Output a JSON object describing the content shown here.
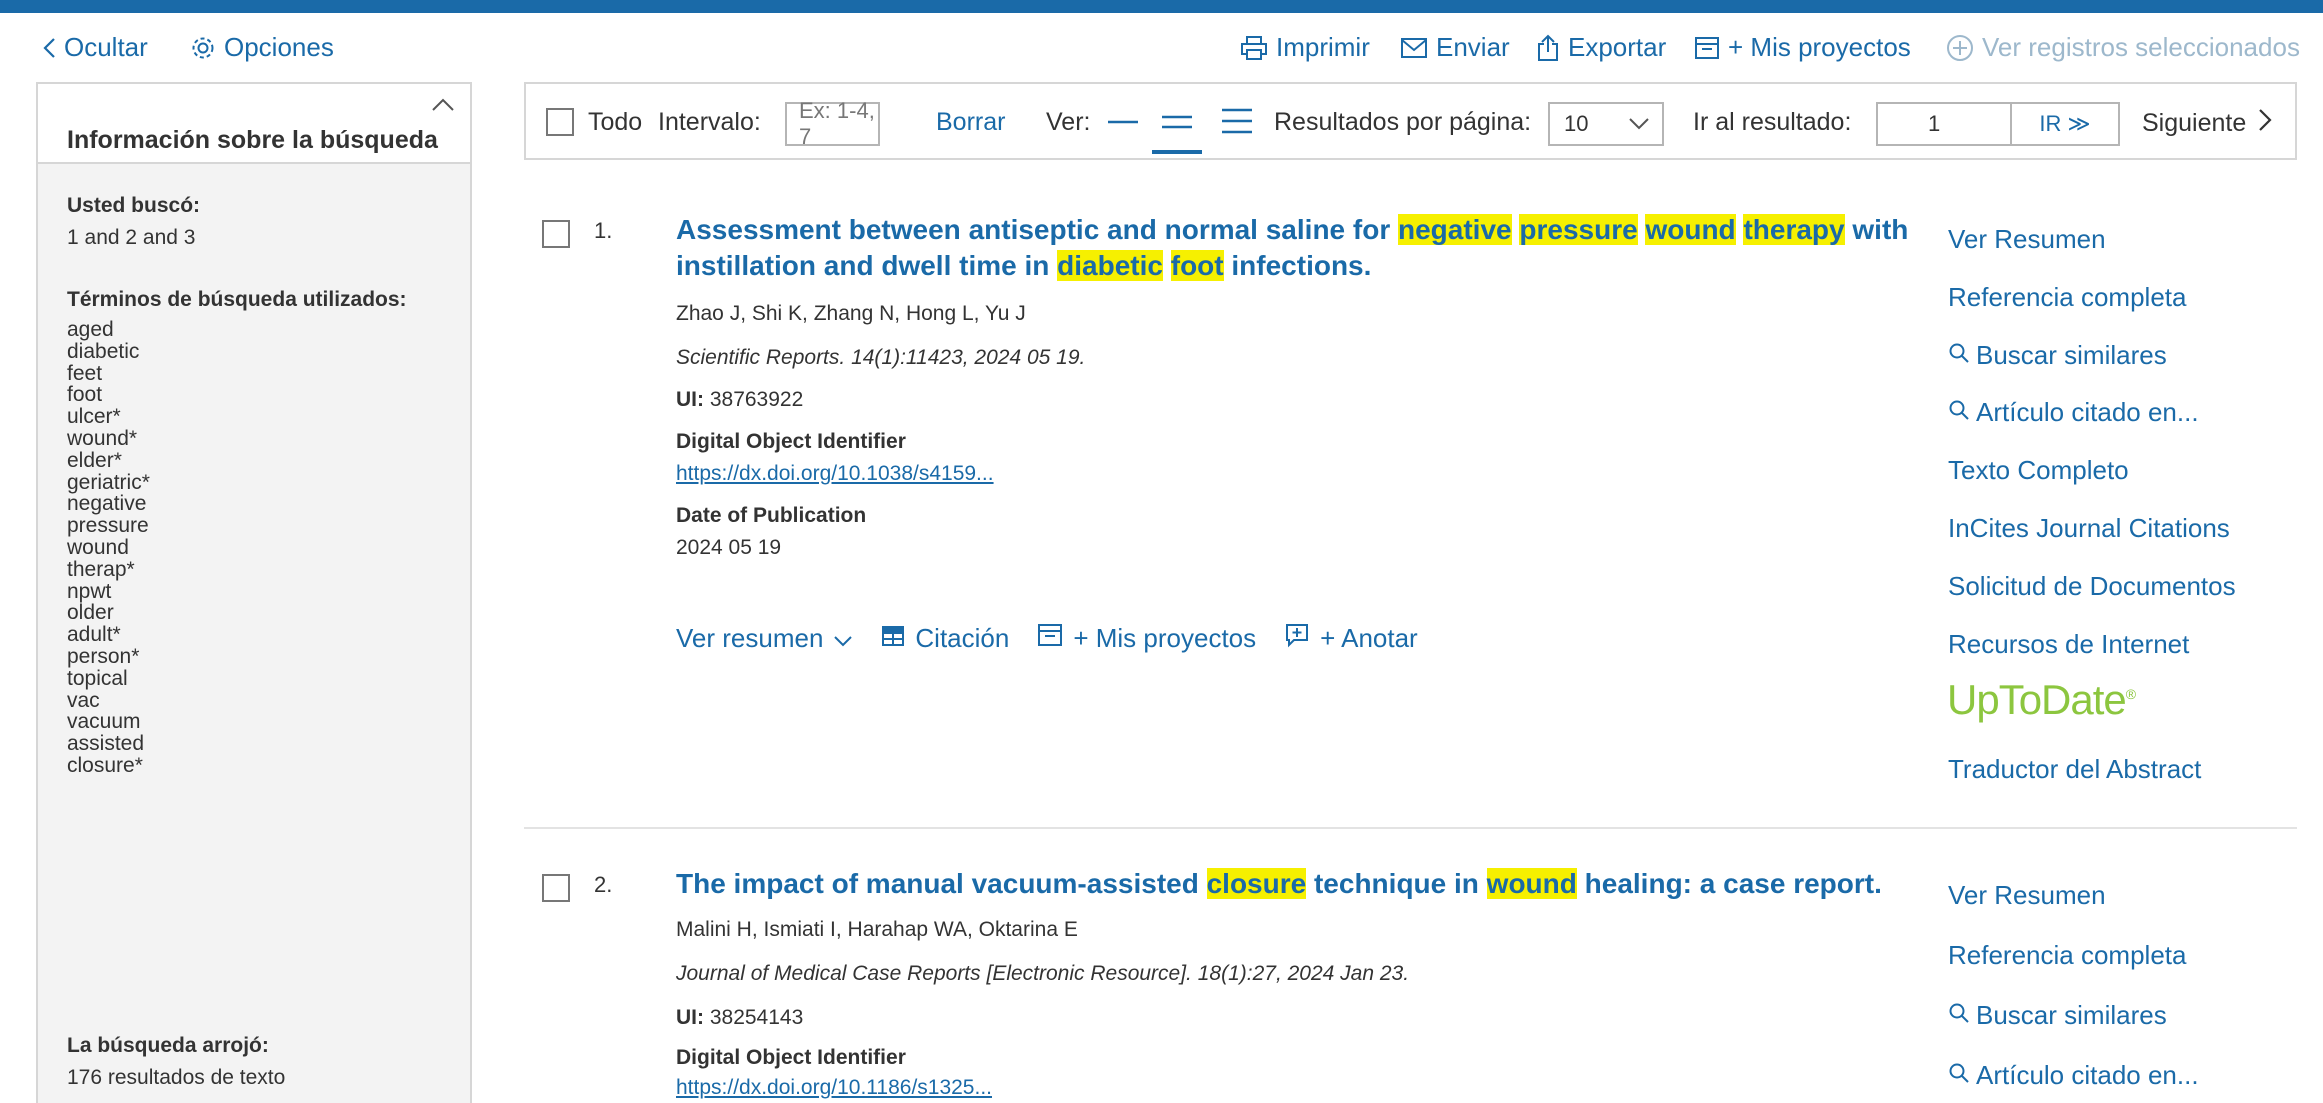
{
  "header": {
    "hide_label": "Ocultar",
    "options_label": "Opciones",
    "print_label": "Imprimir",
    "send_label": "Enviar",
    "export_label": "Exportar",
    "my_projects_label": "+ Mis proyectos",
    "view_selected_label": "Ver registros seleccionados"
  },
  "sidebar": {
    "title": "Información sobre la búsqueda",
    "searched_label": "Usted buscó:",
    "searched_value": "1 and 2 and 3",
    "terms_label": "Términos de búsqueda utilizados:",
    "terms": [
      "aged",
      "diabetic",
      "feet",
      "foot",
      "ulcer*",
      "wound*",
      "elder*",
      "geriatric*",
      "negative",
      "pressure",
      "wound",
      "therap*",
      "npwt",
      "older",
      "adult*",
      "person*",
      "topical",
      "vac",
      "vacuum",
      "assisted",
      "closure*"
    ],
    "results_label": "La búsqueda arrojó:",
    "results_value": "176 resultados de texto"
  },
  "toolbar": {
    "all_label": "Todo",
    "range_label": "Intervalo:",
    "range_placeholder": "Ex: 1-4, 7",
    "clear_label": "Borrar",
    "view_label": "Ver:",
    "per_page_label": "Resultados por página:",
    "per_page_value": "10",
    "goto_label": "Ir al resultado:",
    "goto_value": "1",
    "go_button": "IR ≫",
    "next_label": "Siguiente"
  },
  "results": [
    {
      "number": "1.",
      "title_parts": [
        {
          "t": "Assessment between antiseptic and normal saline for ",
          "h": false
        },
        {
          "t": "negative",
          "h": true
        },
        {
          "t": " ",
          "h": false
        },
        {
          "t": "pressure",
          "h": true
        },
        {
          "t": " ",
          "h": false
        },
        {
          "t": "wound",
          "h": true
        },
        {
          "t": " ",
          "h": false
        },
        {
          "t": "therapy",
          "h": true
        },
        {
          "t": " with instillation and dwell time in ",
          "h": false
        },
        {
          "t": "diabetic",
          "h": true
        },
        {
          "t": " ",
          "h": false
        },
        {
          "t": "foot",
          "h": true
        },
        {
          "t": " infections.",
          "h": false
        }
      ],
      "authors": "Zhao J, Shi K, Zhang N, Hong L, Yu J",
      "source": "Scientific Reports. 14(1):11423, 2024 05 19.",
      "ui_label": "UI:",
      "ui_value": "38763922",
      "doi_label": "Digital Object Identifier",
      "doi_value": "https://dx.doi.org/10.1038/s4159...",
      "date_label": "Date of Publication",
      "date_value": "2024 05 19",
      "actions": {
        "abstract": "Ver resumen",
        "citation": "Citación",
        "projects": "+ Mis proyectos",
        "annotate": "+ Anotar"
      },
      "side_links": [
        "Ver Resumen",
        "Referencia completa",
        "Buscar similares",
        "Artículo citado en...",
        "Texto Completo",
        "InCites Journal Citations",
        "Solicitud de Documentos",
        "Recursos de Internet"
      ],
      "uptodate": "UpToDate",
      "translator": "Traductor del Abstract"
    },
    {
      "number": "2.",
      "title_parts": [
        {
          "t": "The impact of manual vacuum-assisted ",
          "h": false
        },
        {
          "t": "closure",
          "h": true
        },
        {
          "t": " technique in ",
          "h": false
        },
        {
          "t": "wound",
          "h": true
        },
        {
          "t": " healing: a case report.",
          "h": false
        }
      ],
      "authors": "Malini H, Ismiati I, Harahap WA, Oktarina E",
      "source": "Journal of Medical Case Reports [Electronic Resource]. 18(1):27, 2024 Jan 23.",
      "ui_label": "UI:",
      "ui_value": "38254143",
      "doi_label": "Digital Object Identifier",
      "doi_value": "https://dx.doi.org/10.1186/s1325...",
      "side_links": [
        "Ver Resumen",
        "Referencia completa",
        "Buscar similares",
        "Artículo citado en..."
      ]
    }
  ],
  "colors": {
    "accent": "#1a6aa8",
    "highlight": "#f6f000",
    "uptodate": "#8cc63f"
  }
}
